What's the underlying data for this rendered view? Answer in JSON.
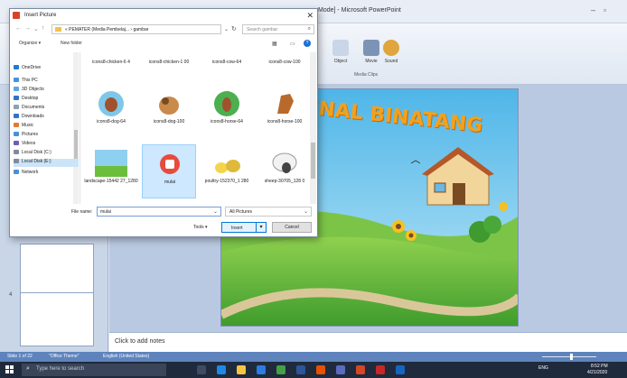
{
  "powerpoint": {
    "title": "Mode] - Microsoft PowerPoint",
    "ribbon": {
      "object_label": "Object",
      "movie_label": "Movie",
      "sound_label": "Sound",
      "group_label": "Media Clips"
    },
    "notes_placeholder": "Click to add notes",
    "slide_title": "ENAL BINATANG",
    "status": {
      "slide_info": "Slide 1 of 22",
      "theme": "\"Office Theme\"",
      "language": "English (United States)"
    },
    "zoom_level": 0.55
  },
  "dialog": {
    "title": "Insert Picture",
    "address": {
      "path": "« PEMATER (Media Pembelaj... › gambar",
      "search_placeholder": "Search gambar"
    },
    "toolbar": {
      "organize": "Organize ▾",
      "new_folder": "New folder"
    },
    "nav_items": [
      {
        "label": "OneDrive",
        "icon_color": "#1e7cd8"
      },
      {
        "label": "This PC",
        "icon_color": "#4a90d9"
      },
      {
        "label": "3D Objects",
        "icon_color": "#5aa6e8"
      },
      {
        "label": "Desktop",
        "icon_color": "#2f73c9"
      },
      {
        "label": "Documents",
        "icon_color": "#8ea0b8"
      },
      {
        "label": "Downloads",
        "icon_color": "#2f73c9"
      },
      {
        "label": "Music",
        "icon_color": "#e07b39"
      },
      {
        "label": "Pictures",
        "icon_color": "#4a90d9"
      },
      {
        "label": "Videos",
        "icon_color": "#6b5fb5"
      },
      {
        "label": "Local Disk (C:)",
        "icon_color": "#7f8c9d"
      },
      {
        "label": "Local Disk (E:)",
        "icon_color": "#7f8c9d"
      },
      {
        "label": "Network",
        "icon_color": "#4a90d9"
      }
    ],
    "files_partial": [
      "icons8-chicken-6 4",
      "icons8-chicken-1 00",
      "icons8-cow-64",
      "icons8-cow-100"
    ],
    "files": [
      {
        "name": "icons8-dog-64",
        "icon": "dog-64-thumb",
        "selected": false
      },
      {
        "name": "icons8-dog-100",
        "icon": "dog-100-thumb",
        "selected": false
      },
      {
        "name": "icons8-horse-64",
        "icon": "horse-64-thumb",
        "selected": false
      },
      {
        "name": "icons8-horse-100",
        "icon": "horse-100-thumb",
        "selected": false
      },
      {
        "name": "landscape-15442 27_1280",
        "icon": "landscape-thumb",
        "selected": false
      },
      {
        "name": "mulai",
        "icon": "mulai-thumb",
        "selected": true
      },
      {
        "name": "poultry-152370_1 280",
        "icon": "poultry-thumb",
        "selected": false
      },
      {
        "name": "sheep-30705_128 0",
        "icon": "sheep-thumb",
        "selected": false
      }
    ],
    "file_name_label": "File name:",
    "file_name_value": "mulai",
    "file_type": "All Pictures",
    "tools_label": "Tools ▾",
    "insert_label": "Insert",
    "cancel_label": "Cancel"
  },
  "taskbar": {
    "search_placeholder": "Type here to search",
    "tray_lang": "ENG",
    "time": "8:52 PM",
    "date": "4/21/2020"
  }
}
